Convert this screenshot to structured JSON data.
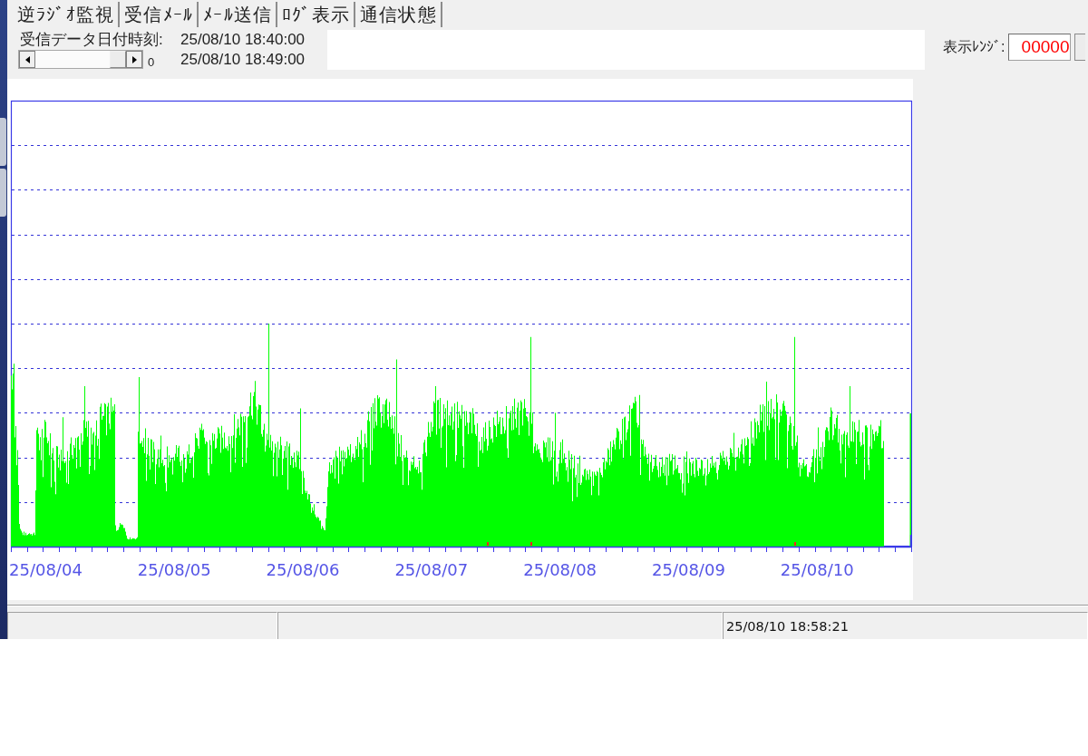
{
  "tabs": [
    {
      "label": "逆ﾗｼﾞｵ監視"
    },
    {
      "label": "受信ﾒｰﾙ"
    },
    {
      "label": "ﾒｰﾙ送信"
    },
    {
      "label": "ﾛｸﾞ表示"
    },
    {
      "label": "通信状態"
    }
  ],
  "header": {
    "date_label": "受信データ日付時刻:",
    "start_time": "25/08/10 18:40:00",
    "scroll_value": "0",
    "end_time": "25/08/10 18:49:00"
  },
  "range": {
    "label": "表示ﾚﾝｼﾞ:",
    "value": "00000"
  },
  "chart": {
    "x_labels": [
      "25/08/04",
      "25/08/05",
      "25/08/06",
      "25/08/07",
      "25/08/08",
      "25/08/09",
      "25/08/10"
    ]
  },
  "status_bar": {
    "time": "25/08/10 18:58:21"
  }
}
